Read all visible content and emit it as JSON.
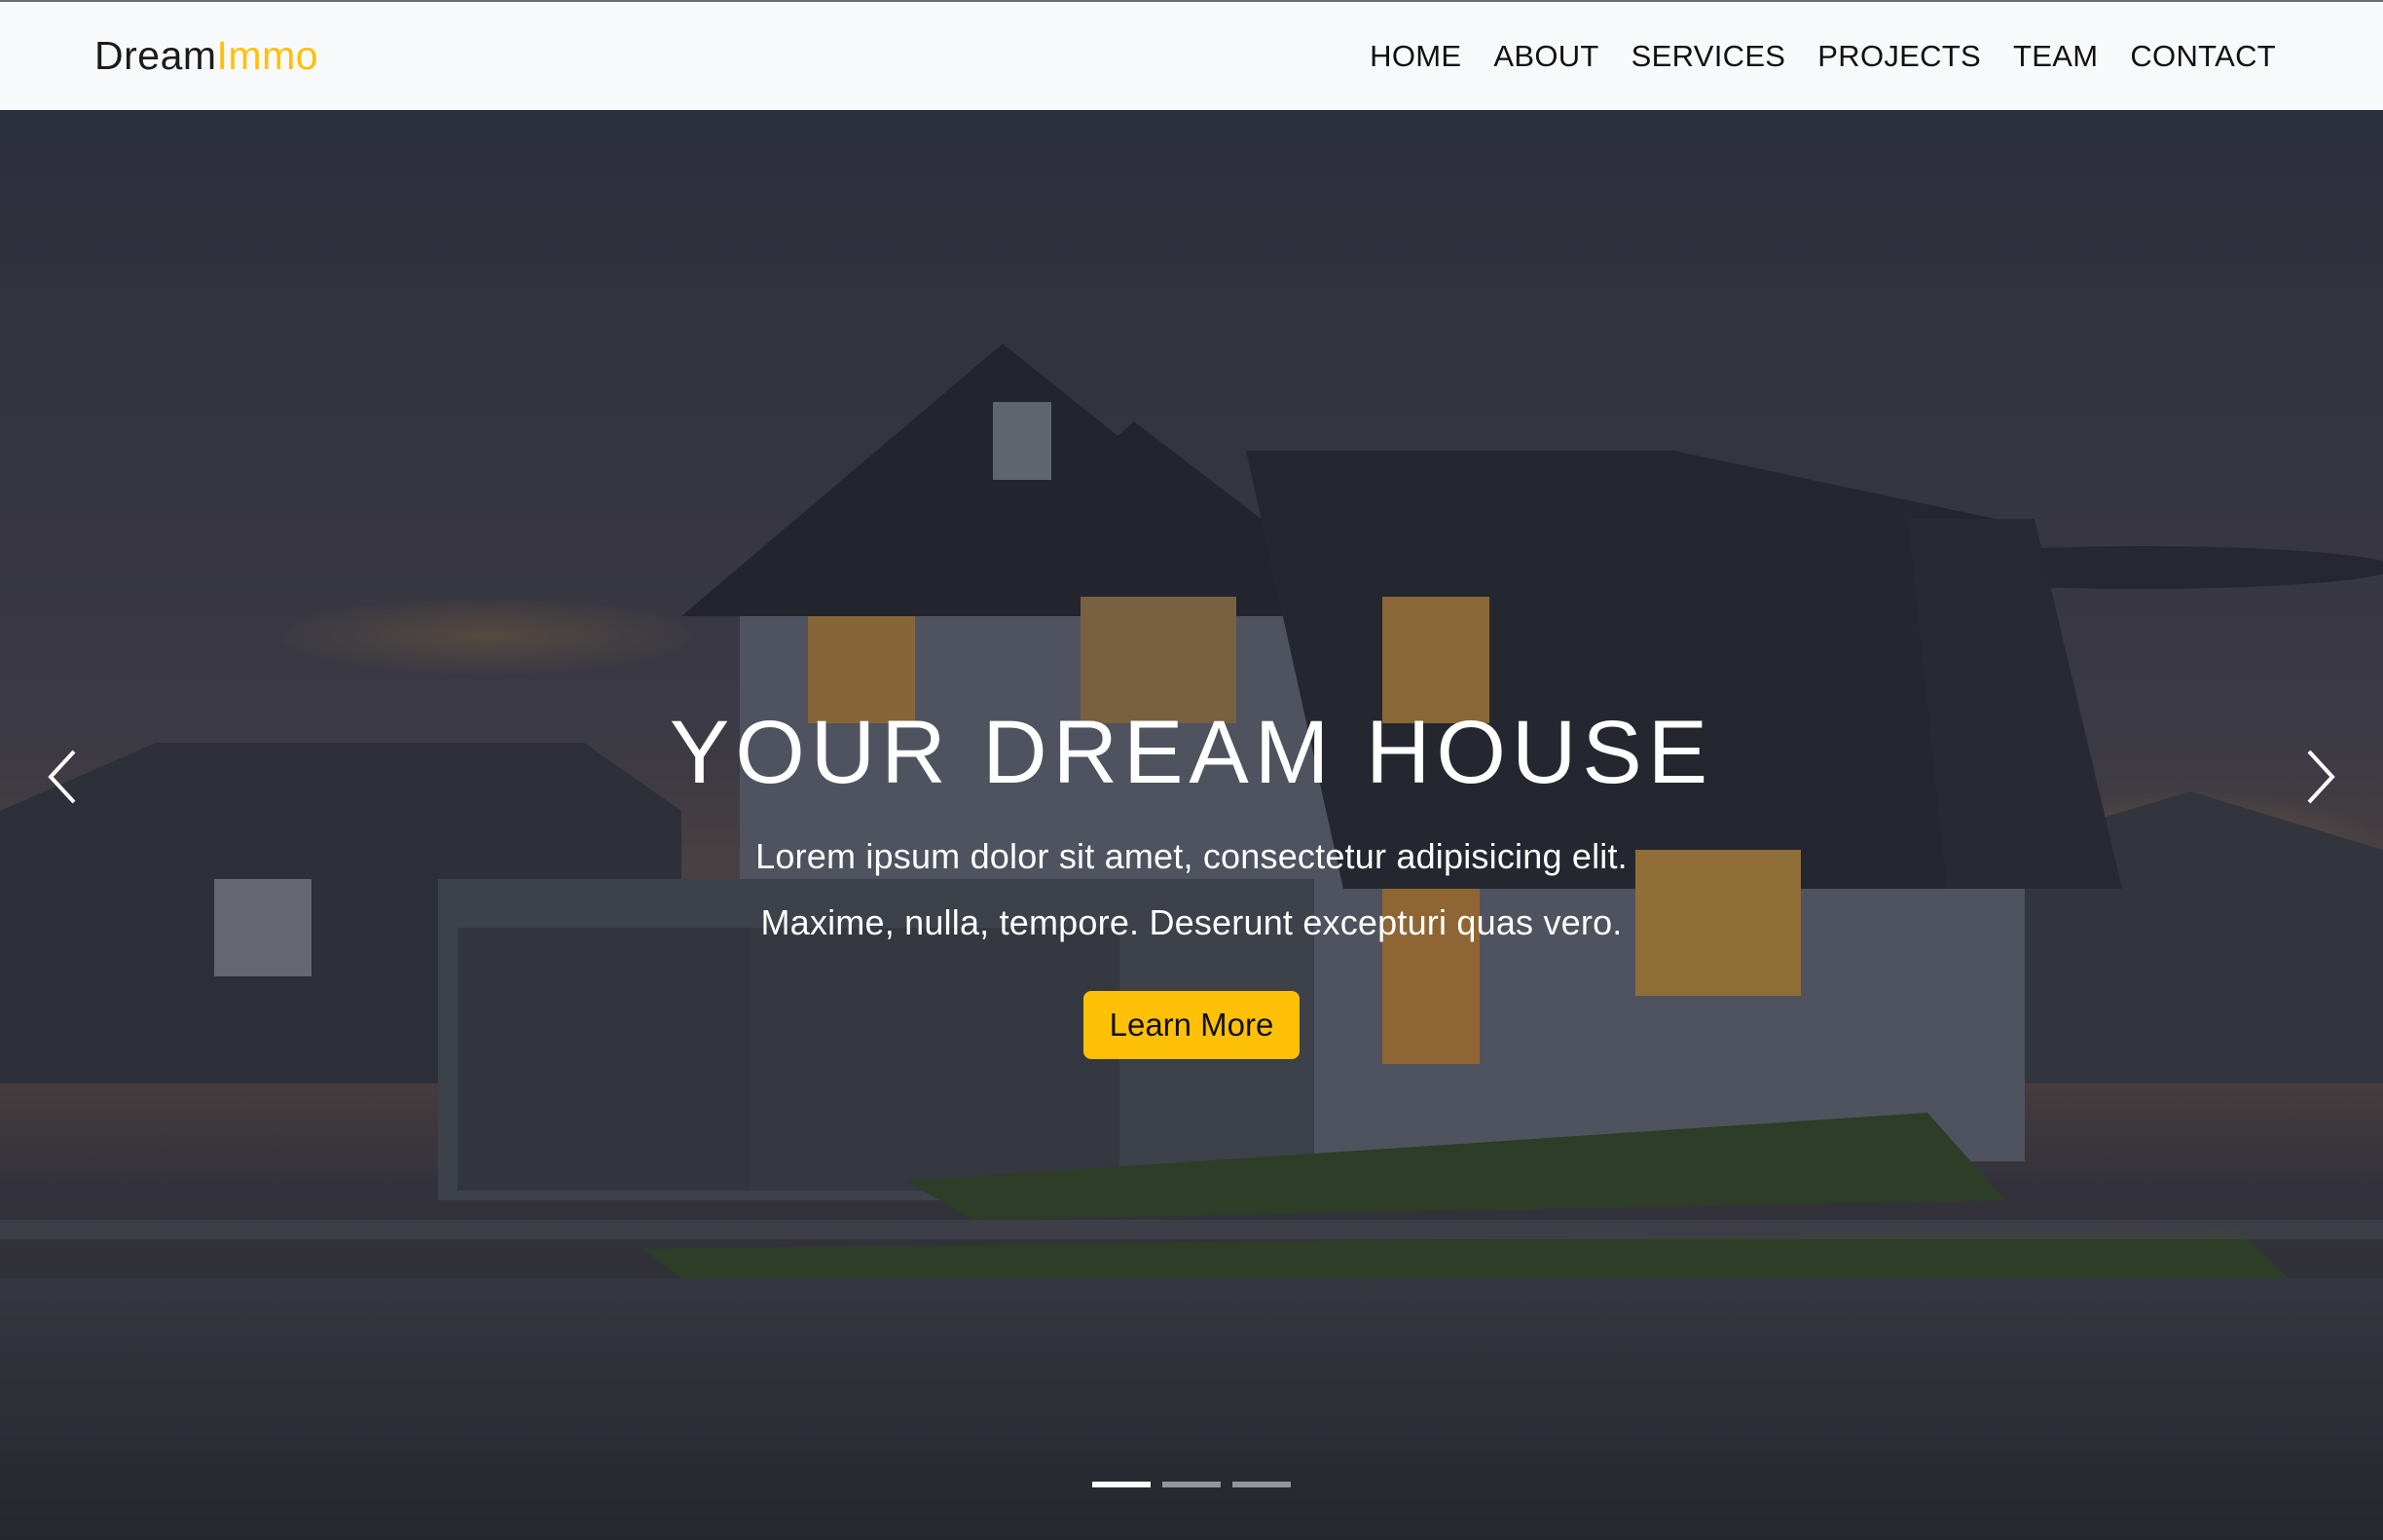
{
  "brand": {
    "name_part1": "Dream",
    "name_part2": "Immo",
    "accent_color": "#ffc107"
  },
  "nav": {
    "items": [
      {
        "label": "HOME"
      },
      {
        "label": "ABOUT"
      },
      {
        "label": "SERVICES"
      },
      {
        "label": "PROJECTS"
      },
      {
        "label": "TEAM"
      },
      {
        "label": "CONTACT"
      }
    ]
  },
  "hero": {
    "title": "YOUR DREAM HOUSE",
    "line1": "Lorem ipsum dolor sit amet, consectetur adipisicing elit.",
    "line2": "Maxime, nulla, tempore. Deserunt excepturi quas vero.",
    "button_label": "Learn More",
    "background_image": "house-at-dusk",
    "prev_icon": "chevron-left-icon",
    "next_icon": "chevron-right-icon",
    "slides_total": 3,
    "active_slide": 1
  }
}
